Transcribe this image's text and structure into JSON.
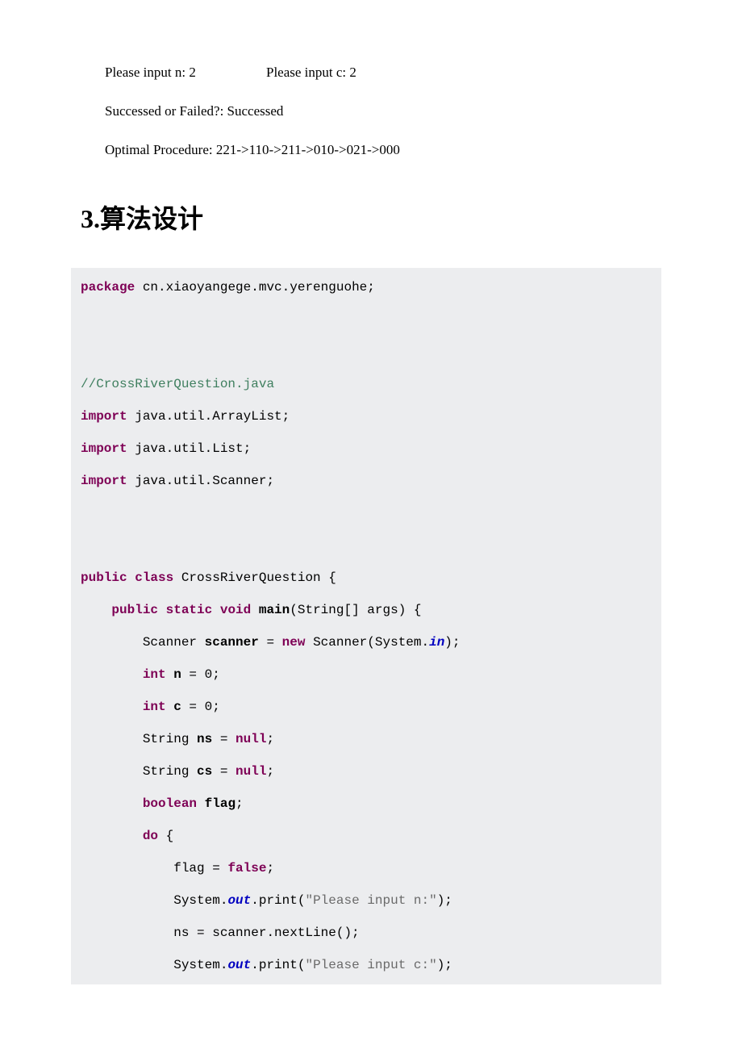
{
  "output": {
    "line1_col1": "Please input n: 2",
    "line1_col2": "Please input c: 2",
    "line2": "Successed or Failed?: Successed",
    "line3": "Optimal Procedure: 221->110->211->010->021->000"
  },
  "heading": "3.算法设计",
  "code": {
    "l1_package": "package",
    "l1_pkgname": " cn.xiaoyangege.mvc.yerenguohe;",
    "l2_comment": "//CrossRiverQuestion.java",
    "l3_import": "import",
    "l3_val": " java.util.ArrayList;",
    "l4_import": "import",
    "l4_val": " java.util.List;",
    "l5_import": "import",
    "l5_val": " java.util.Scanner;",
    "l6_public": "public",
    "l6_class": " class",
    "l6_name": " CrossRiverQuestion {",
    "l7_indent": "    ",
    "l7_public": "public",
    "l7_static": " static",
    "l7_void": " void",
    "l7_main": " main",
    "l7_args": "(String[] args) {",
    "l8_indent": "        ",
    "l8_text1": "Scanner ",
    "l8_var": "scanner",
    "l8_text2": " = ",
    "l8_new": "new",
    "l8_text3": " Scanner(System.",
    "l8_in": "in",
    "l8_text4": ");",
    "l9_indent": "        ",
    "l9_int": "int",
    "l9_var": " n",
    "l9_rest": " = 0;",
    "l10_indent": "        ",
    "l10_int": "int",
    "l10_var": " c",
    "l10_rest": " = 0;",
    "l11_indent": "        ",
    "l11_text1": "String ",
    "l11_var": "ns",
    "l11_text2": " = ",
    "l11_null": "null",
    "l11_text3": ";",
    "l12_indent": "        ",
    "l12_text1": "String ",
    "l12_var": "cs",
    "l12_text2": " = ",
    "l12_null": "null",
    "l12_text3": ";",
    "l13_indent": "        ",
    "l13_bool": "boolean",
    "l13_var": " flag",
    "l13_text": ";",
    "l14_indent": "        ",
    "l14_do": "do",
    "l14_text": " {",
    "l15_indent": "            ",
    "l15_text1": "flag = ",
    "l15_false": "false",
    "l15_text2": ";",
    "l16_indent": "            ",
    "l16_text1": "System.",
    "l16_out": "out",
    "l16_text2": ".print(",
    "l16_str": "\"Please input n:\"",
    "l16_text3": ");",
    "l17_indent": "            ",
    "l17_text": "ns = scanner.nextLine();",
    "l18_indent": "            ",
    "l18_text1": "System.",
    "l18_out": "out",
    "l18_text2": ".print(",
    "l18_str": "\"Please input c:\"",
    "l18_text3": ");"
  }
}
